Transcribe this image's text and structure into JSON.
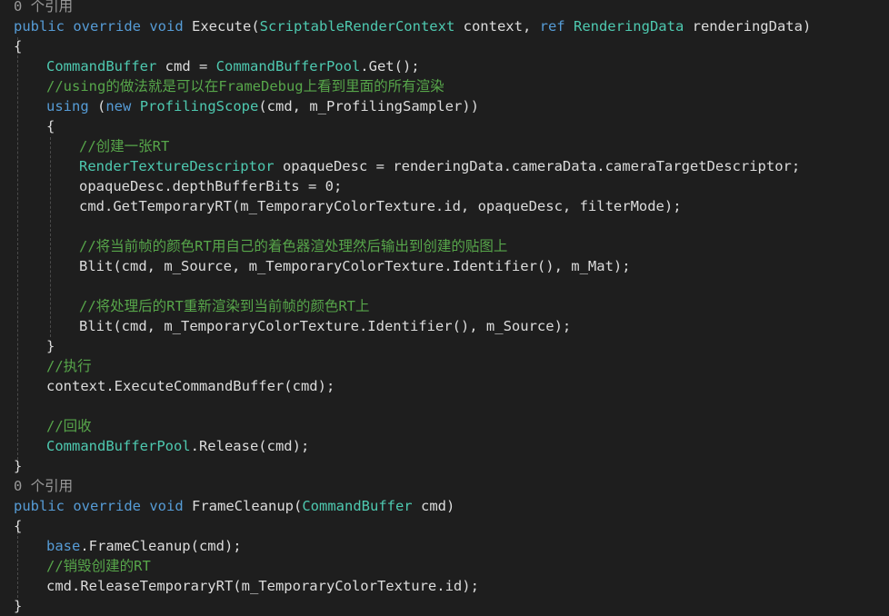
{
  "colors": {
    "background": "#1e1e1e",
    "keyword": "#569cd6",
    "type": "#4ec9b0",
    "comment": "#57a64a",
    "text": "#dcdcdc",
    "codelens": "#999999"
  },
  "lines": [
    {
      "indent": 0,
      "kind": "codelens",
      "tokens": [
        {
          "t": "0 个引用",
          "c": "lens"
        }
      ]
    },
    {
      "indent": 0,
      "tokens": [
        {
          "t": "public",
          "c": "kw"
        },
        {
          "t": " "
        },
        {
          "t": "override",
          "c": "kw"
        },
        {
          "t": " "
        },
        {
          "t": "void",
          "c": "kw"
        },
        {
          "t": " Execute("
        },
        {
          "t": "ScriptableRenderContext",
          "c": "ty"
        },
        {
          "t": " context, "
        },
        {
          "t": "ref",
          "c": "kw"
        },
        {
          "t": " "
        },
        {
          "t": "RenderingData",
          "c": "ty"
        },
        {
          "t": " renderingData)"
        }
      ]
    },
    {
      "indent": 0,
      "tokens": [
        {
          "t": "{"
        }
      ]
    },
    {
      "indent": 1,
      "tokens": [
        {
          "t": "CommandBuffer",
          "c": "ty"
        },
        {
          "t": " cmd = "
        },
        {
          "t": "CommandBufferPool",
          "c": "ty"
        },
        {
          "t": ".Get();"
        }
      ]
    },
    {
      "indent": 1,
      "tokens": [
        {
          "t": "//using的做法就是可以在FrameDebug上看到里面的所有渲染",
          "c": "cm"
        }
      ]
    },
    {
      "indent": 1,
      "tokens": [
        {
          "t": "using",
          "c": "kw"
        },
        {
          "t": " ("
        },
        {
          "t": "new",
          "c": "kw"
        },
        {
          "t": " "
        },
        {
          "t": "ProfilingScope",
          "c": "ty"
        },
        {
          "t": "(cmd, m_ProfilingSampler))"
        }
      ]
    },
    {
      "indent": 1,
      "tokens": [
        {
          "t": "{"
        }
      ]
    },
    {
      "indent": 2,
      "tokens": [
        {
          "t": "//创建一张RT",
          "c": "cm"
        }
      ]
    },
    {
      "indent": 2,
      "tokens": [
        {
          "t": "RenderTextureDescriptor",
          "c": "ty"
        },
        {
          "t": " opaqueDesc = renderingData.cameraData.cameraTargetDescriptor;"
        }
      ]
    },
    {
      "indent": 2,
      "tokens": [
        {
          "t": "opaqueDesc.depthBufferBits = 0;"
        }
      ]
    },
    {
      "indent": 2,
      "tokens": [
        {
          "t": "cmd.GetTemporaryRT(m_TemporaryColorTexture.id, opaqueDesc, filterMode);"
        }
      ]
    },
    {
      "indent": 2,
      "tokens": []
    },
    {
      "indent": 2,
      "tokens": [
        {
          "t": "//将当前帧的颜色RT用自己的着色器渲处理然后输出到创建的贴图上",
          "c": "cm"
        }
      ]
    },
    {
      "indent": 2,
      "tokens": [
        {
          "t": "Blit(cmd, m_Source, m_TemporaryColorTexture.Identifier(), m_Mat);"
        }
      ]
    },
    {
      "indent": 2,
      "tokens": []
    },
    {
      "indent": 2,
      "tokens": [
        {
          "t": "//将处理后的RT重新渲染到当前帧的颜色RT上",
          "c": "cm"
        }
      ]
    },
    {
      "indent": 2,
      "tokens": [
        {
          "t": "Blit(cmd, m_TemporaryColorTexture.Identifier(), m_Source);"
        }
      ]
    },
    {
      "indent": 1,
      "tokens": [
        {
          "t": "}"
        }
      ]
    },
    {
      "indent": 1,
      "tokens": [
        {
          "t": "//执行",
          "c": "cm"
        }
      ]
    },
    {
      "indent": 1,
      "tokens": [
        {
          "t": "context.ExecuteCommandBuffer(cmd);"
        }
      ]
    },
    {
      "indent": 1,
      "tokens": []
    },
    {
      "indent": 1,
      "tokens": [
        {
          "t": "//回收",
          "c": "cm"
        }
      ]
    },
    {
      "indent": 1,
      "tokens": [
        {
          "t": "CommandBufferPool",
          "c": "ty"
        },
        {
          "t": ".Release(cmd);"
        }
      ]
    },
    {
      "indent": 0,
      "tokens": [
        {
          "t": "}"
        }
      ]
    },
    {
      "indent": 0,
      "kind": "codelens",
      "tokens": [
        {
          "t": "0 个引用",
          "c": "lens"
        }
      ]
    },
    {
      "indent": 0,
      "tokens": [
        {
          "t": "public",
          "c": "kw"
        },
        {
          "t": " "
        },
        {
          "t": "override",
          "c": "kw"
        },
        {
          "t": " "
        },
        {
          "t": "void",
          "c": "kw"
        },
        {
          "t": " FrameCleanup("
        },
        {
          "t": "CommandBuffer",
          "c": "ty"
        },
        {
          "t": " cmd)"
        }
      ]
    },
    {
      "indent": 0,
      "tokens": [
        {
          "t": "{"
        }
      ]
    },
    {
      "indent": 1,
      "tokens": [
        {
          "t": "base",
          "c": "kw"
        },
        {
          "t": ".FrameCleanup(cmd);"
        }
      ]
    },
    {
      "indent": 1,
      "tokens": [
        {
          "t": "//销毁创建的RT",
          "c": "cm"
        }
      ]
    },
    {
      "indent": 1,
      "tokens": [
        {
          "t": "cmd.ReleaseTemporaryRT(m_TemporaryColorTexture.id);"
        }
      ]
    },
    {
      "indent": 0,
      "tokens": [
        {
          "t": "}"
        }
      ]
    }
  ]
}
